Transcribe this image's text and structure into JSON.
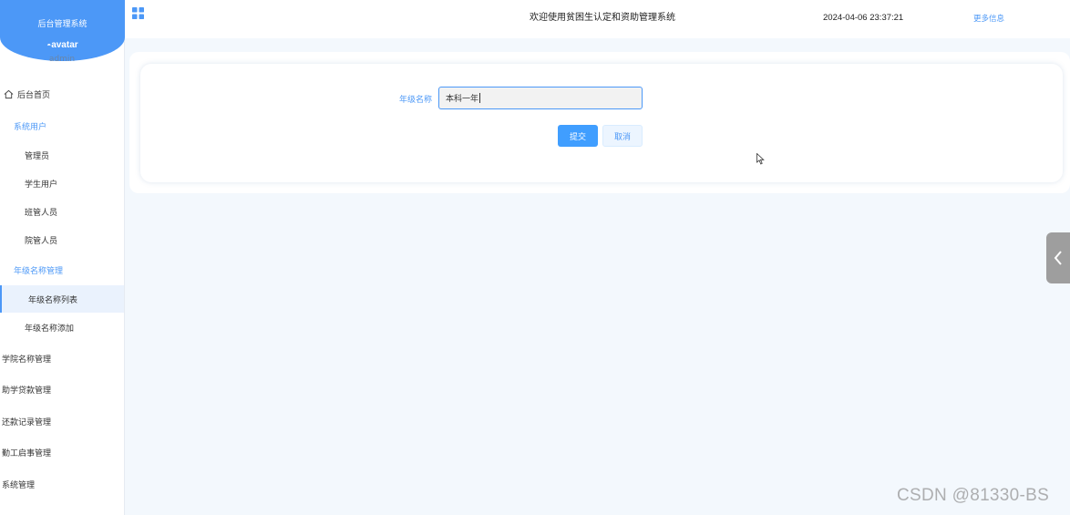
{
  "sidebar": {
    "brand_title": "后台管理系统",
    "avatar_alt": "avatar",
    "username": "admin",
    "menu": {
      "home": "后台首页",
      "group_users": "系统用户",
      "admin": "管理员",
      "student_user": "学生用户",
      "class_staff": "班管人员",
      "college_staff": "院管人员",
      "group_grade": "年级名称管理",
      "grade_list": "年级名称列表",
      "grade_add": "年级名称添加",
      "college_mgmt": "学院名称管理",
      "loan_mgmt": "助学贷款管理",
      "repay_mgmt": "还款记录管理",
      "workstudy_mgmt": "勤工启事管理",
      "system_mgmt": "系统管理"
    }
  },
  "header": {
    "title": "欢迎使用贫困生认定和资助管理系统",
    "datetime": "2024-04-06 23:37:21",
    "more_info": "更多信息"
  },
  "form": {
    "grade_label": "年级名称",
    "grade_value": "本科一年",
    "submit_label": "提交",
    "cancel_label": "取消"
  },
  "watermark": "CSDN @81330-BS",
  "colors": {
    "brand": "#4c98f7",
    "primary_button": "#409eff",
    "page_background": "#f3f8fd"
  },
  "icons": {
    "header_menu": "grid-icon",
    "home": "home-icon",
    "drawer_toggle": "chevron-left-icon",
    "mouse": "cursor-icon"
  }
}
